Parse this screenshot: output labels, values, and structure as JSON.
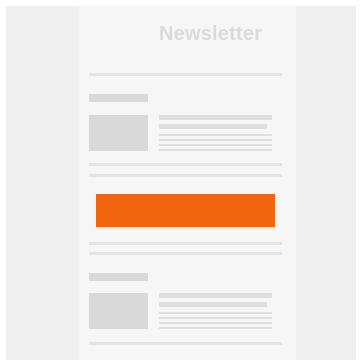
{
  "newsletter": {
    "title": "Newsletter",
    "accent_color": "#f0650e",
    "placeholder_color": "#d9d9d9",
    "sheet_color": "#f6f6f6",
    "backdrop_color": "#efefef"
  }
}
